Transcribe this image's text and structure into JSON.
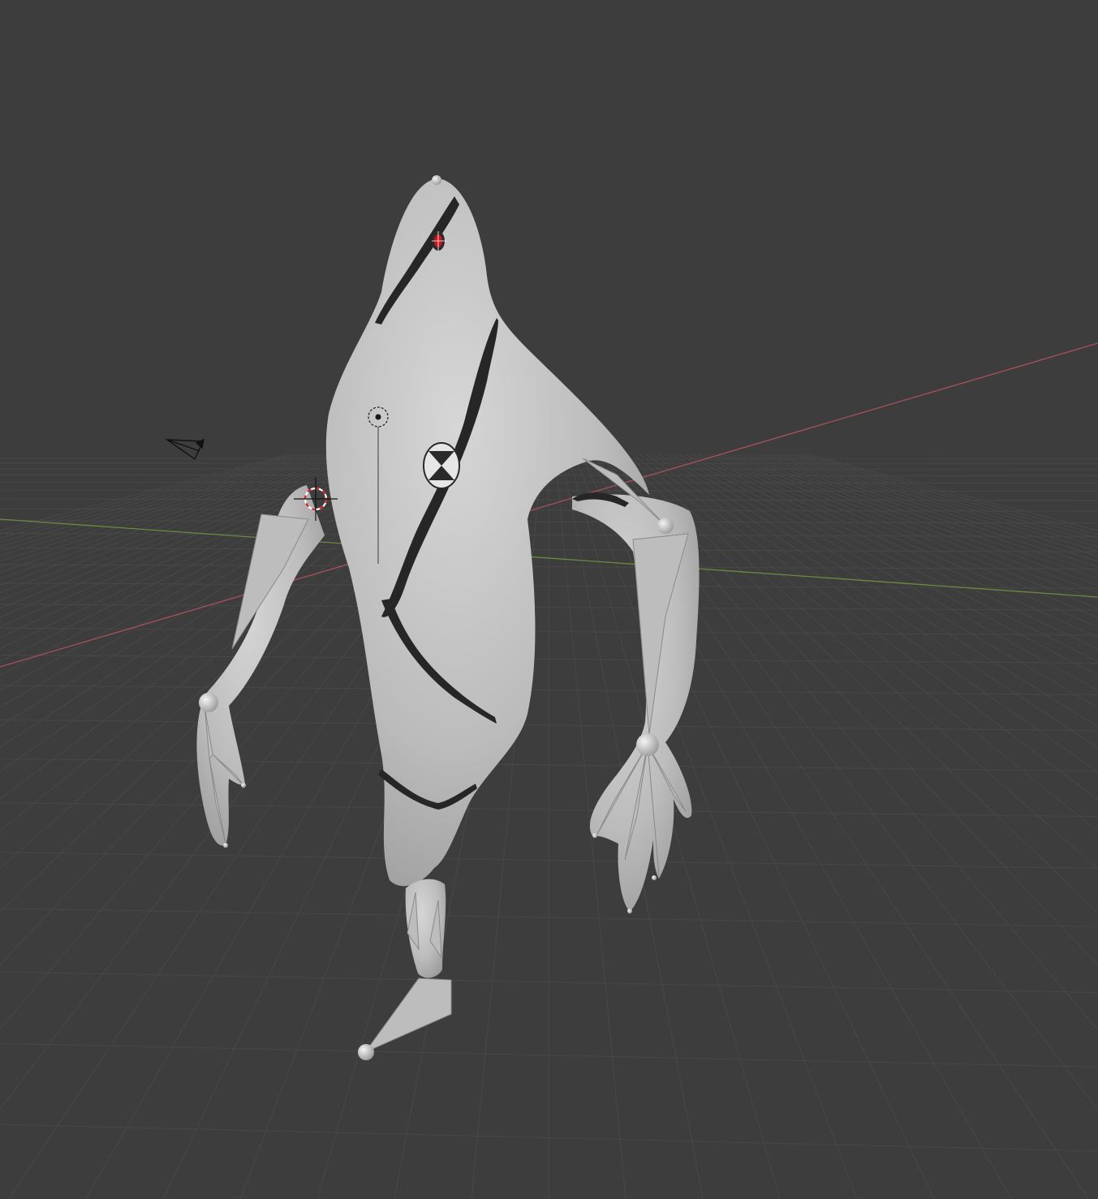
{
  "viewport": {
    "background_color": "#3d3d3d",
    "grid_color": "#484848",
    "x_axis_color": "#a7525a",
    "y_axis_color": "#6b8a3f"
  },
  "scene": {
    "character_skin_color": "#c8c8c8",
    "crack_color": "#262626",
    "eye_color": "#c8141e",
    "bone_color": "#bdbdbd",
    "objects": {
      "camera": "camera-icon",
      "light": "light-icon",
      "cursor": "3d-cursor-icon",
      "armature": "armature-bones"
    }
  }
}
